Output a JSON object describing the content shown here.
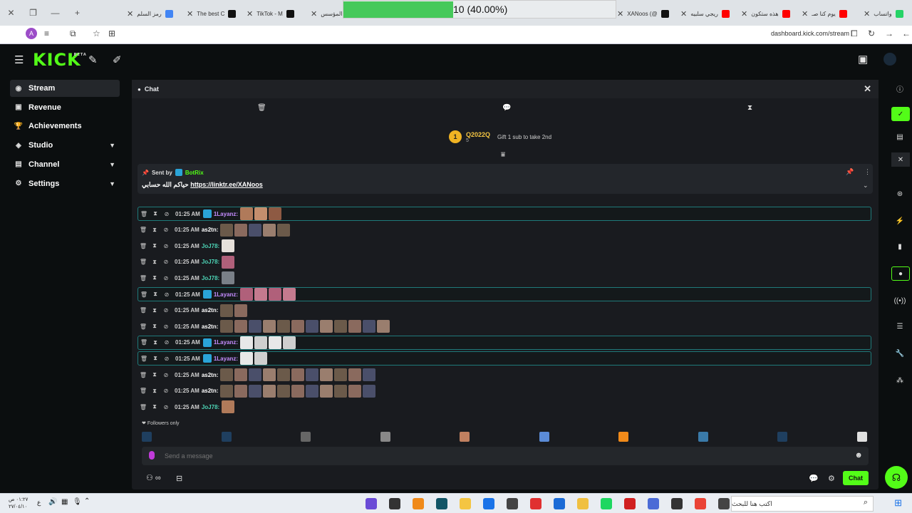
{
  "browser": {
    "tabs": [
      {
        "label": "واتساب",
        "color": "#25d366"
      },
      {
        "label": "يوم كنا صـ",
        "color": "#ff0000"
      },
      {
        "label": "هذه ستكون",
        "color": "#ff0000"
      },
      {
        "label": "ريجي سلبيه",
        "color": "#ff0000"
      },
      {
        "label": "XANoos (@",
        "color": "#111111"
      },
      {
        "label": "المؤسس",
        "color": "#111111"
      },
      {
        "label": "TikTok - M",
        "color": "#111111"
      },
      {
        "label": "The best C",
        "color": "#111111"
      },
      {
        "label": "رمز السلم",
        "color": "#4285f4"
      }
    ],
    "progress": {
      "label": "10 (40.00%)",
      "fraction": 0.4
    },
    "url": "dashboard.kick.com/stream",
    "profile_initial": "A"
  },
  "app": {
    "logo": "KICK",
    "logo_tag": "BETA"
  },
  "sidebar": {
    "items": [
      {
        "label": "Stream",
        "icon": "broadcast-icon",
        "glyph": "◉"
      },
      {
        "label": "Revenue",
        "icon": "revenue-icon",
        "glyph": "▣"
      },
      {
        "label": "Achievements",
        "icon": "trophy-icon",
        "glyph": "🏆"
      },
      {
        "label": "Studio",
        "icon": "studio-icon",
        "glyph": "◈"
      },
      {
        "label": "Channel",
        "icon": "channel-icon",
        "glyph": "▤"
      },
      {
        "label": "Settings",
        "icon": "gear-icon",
        "glyph": "⚙"
      }
    ]
  },
  "chat": {
    "title": "Chat",
    "leader": {
      "rank": "1",
      "name": "Q2022Q",
      "count": "5",
      "gift_text": "Gift 1 sub to take 2nd"
    },
    "pinned": {
      "sent_by": "Sent by",
      "bot": "BotRix",
      "text_ar": "حياكم الله حسابي",
      "link": "https://linktr.ee/XANoos"
    },
    "messages": [
      {
        "time": "01:25 AM",
        "user": "1Layanz",
        "color": "#c58cff",
        "badge": true,
        "hl": true,
        "emotes": 3,
        "palette": "warm"
      },
      {
        "time": "01:25 AM",
        "user": "as2tn",
        "color": "#ffffff",
        "badge": false,
        "hl": false,
        "emotes": 5,
        "palette": "mixed"
      },
      {
        "time": "01:25 AM",
        "user": "JoJ78",
        "color": "#4cd3b5",
        "badge": false,
        "hl": false,
        "emotes": 1,
        "palette": "light"
      },
      {
        "time": "01:25 AM",
        "user": "JoJ78",
        "color": "#4cd3b5",
        "badge": false,
        "hl": false,
        "emotes": 1,
        "palette": "pink"
      },
      {
        "time": "01:25 AM",
        "user": "JoJ78",
        "color": "#4cd3b5",
        "badge": false,
        "hl": false,
        "emotes": 1,
        "palette": "grey"
      },
      {
        "time": "01:25 AM",
        "user": "1Layanz",
        "color": "#c58cff",
        "badge": true,
        "hl": true,
        "emotes": 4,
        "palette": "pink"
      },
      {
        "time": "01:25 AM",
        "user": "as2tn",
        "color": "#ffffff",
        "badge": false,
        "hl": false,
        "emotes": 2,
        "palette": "mixed"
      },
      {
        "time": "01:25 AM",
        "user": "as2tn",
        "color": "#ffffff",
        "badge": false,
        "hl": false,
        "emotes": 12,
        "palette": "mixed"
      },
      {
        "time": "01:25 AM",
        "user": "1Layanz",
        "color": "#c58cff",
        "badge": true,
        "hl": true,
        "emotes": 4,
        "palette": "white"
      },
      {
        "time": "01:25 AM",
        "user": "1Layanz",
        "color": "#c58cff",
        "badge": true,
        "hl": true,
        "emotes": 2,
        "palette": "white"
      },
      {
        "time": "01:25 AM",
        "user": "as2tn",
        "color": "#ffffff",
        "badge": false,
        "hl": false,
        "emotes": 11,
        "palette": "mixed"
      },
      {
        "time": "01:25 AM",
        "user": "as2tn",
        "color": "#ffffff",
        "badge": false,
        "hl": false,
        "emotes": 11,
        "palette": "mixed"
      },
      {
        "time": "01:25 AM",
        "user": "JoJ78",
        "color": "#4cd3b5",
        "badge": false,
        "hl": false,
        "emotes": 1,
        "palette": "warm"
      }
    ],
    "followers_only": "Followers only",
    "input_placeholder": "Send a message",
    "send_label": "Chat"
  },
  "taskbar": {
    "search_placeholder": "اكتب هنا للبحث",
    "time": "٠١:٢٧ ص",
    "date": "٢٧/٠٤/١٠",
    "lang": "ع"
  }
}
